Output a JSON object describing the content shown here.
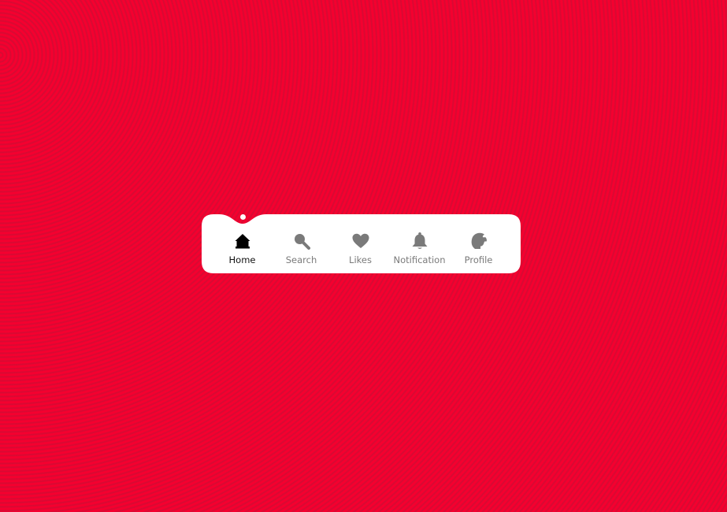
{
  "colors": {
    "background": "#f0002d",
    "bar": "#ffffff",
    "active": "#000000",
    "inactive": "#7a7a7a"
  },
  "nav": {
    "active_index": 0,
    "items": [
      {
        "label": "Home",
        "icon": "home-icon"
      },
      {
        "label": "Search",
        "icon": "search-icon"
      },
      {
        "label": "Likes",
        "icon": "heart-icon"
      },
      {
        "label": "Notification",
        "icon": "bell-icon"
      },
      {
        "label": "Profile",
        "icon": "profile-icon"
      }
    ]
  }
}
